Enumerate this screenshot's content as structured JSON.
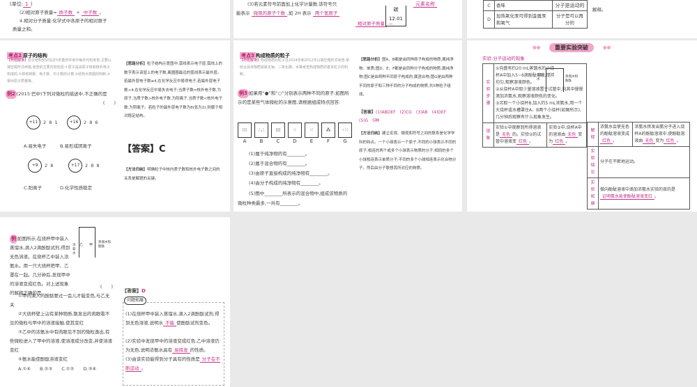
{
  "top_left": {
    "l1": "(2)相对原子质量≈",
    "a1": "质子数",
    "plus": "+",
    "a2": "中子数",
    "l2": "4.相对分子质量:化学式中各原子的相对原子",
    "l3": "质量之和。",
    "unit": "(单位:",
    "unit_a": "1"
  },
  "top_mid": {
    "l1": "(3)若元素符号前面加上化学计量数,该符号只",
    "l2": "能表示",
    "a1": "微观的原子个数",
    "l3": ",如 2H 表示",
    "a2": "两个氢原子",
    "box_label": "碳",
    "box_value": "12.01",
    "a3": "相对原子质量",
    "a4": "元素名称"
  },
  "top_right": {
    "rows": [
      {
        "k": "C",
        "d": "香味",
        "e": "分子是运动的"
      },
      {
        "k": "D",
        "d": "加热氧化汞可得到金属汞和氧气",
        "e": "分子是可以再分的"
      }
    ],
    "note": "解释。"
  },
  "p1": {
    "tag": "考点2",
    "title": "原子的结构",
    "intro_label": "【命题解读】",
    "intro": "原子结构知识在近5年重庆中考中每年均有考查,主要以填空题形式命题,考查的主要内容包括:①原子是由原子核和核外电子构成的,②核电荷数、电子数、中子数的计算,③结构示意图的判断,④相对原子质量等。",
    "ex_label": "例2",
    "q": "(2015·巴中)下列对微粒的描述中,不正确的是",
    "paren": "(　　)",
    "options": [
      {
        "core": "+11",
        "shells": "2 8 1",
        "label": "A.易失电子"
      },
      {
        "core": "+16",
        "shells": "2 8 6",
        "label": "B.易形成阴离子"
      },
      {
        "core": "+9",
        "shells": "2 8",
        "label": "C.阳离子"
      },
      {
        "core": "+17",
        "shells": "2 8 8",
        "label": "D.化学性质稳定"
      }
    ],
    "analysis_label": "【思路分析】",
    "analysis": "粒子结构示意图中,弧线表示电子层,弧线上的数字表示该层上的电子数,离圆圈最远的弧线表示最外层。若最外层电子数≥4,在化学反应中易得电子,若最外层电子数<4,在化学反应中易失去电子;当质子数=核外电子数,为原子,当质子数>核外电子数,为阳离子,当质子数<核外电子数,为阴离子。若粒子的最外层电子数为8(氦为2),则属于相对稳定结构。",
    "answer_label": "【答案】",
    "answer": "C",
    "method_label": "【方法归纳】",
    "method": "明确粒子中核内质子数和核外电子数之间的关系是解题的关键。"
  },
  "p2": {
    "tag": "考点3",
    "title": "构成物质的粒子",
    "intro_label": "【命题解读】",
    "intro": "构成物质的粒子在2014年和2012年以填空题形式考查,常结合具体物质如氯化钠、二氧化碳、水等考查构成物质的基本粒子的判断。",
    "ex_label": "例3",
    "q": "如果用“●”和“○”分别表示两种不同的原子,如图所示的是某些气体微粒的示意图,请根据组成特点回答:",
    "boxes": [
      "A",
      "B",
      "C",
      "D",
      "E",
      "F",
      "G"
    ],
    "qs": [
      "(1)属于纯净物的有________。",
      "(2)属于混合物的有________。",
      "(3)由原子直接构成的纯净物有________。",
      "(4)由分子构成的纯净物有________。",
      "(5)图中________所表示的混合物中,组成该物质的微粒种类最多,一共有________。"
    ],
    "analysis_label": "【思路分析】",
    "analysis": "图A、B都是由同种原子构成的物质,属纯净物、单质;图D、E、F都是由同种分子构成的物质,属纯净物;图C是由两种不同原子构成的,属混合物;图G是由两种不同的原子和三种不同的分子构成的物质,共5种粒子组成。",
    "answer_label": "【答案】",
    "answer": "(1)ABDEF　(2)CG　(3)AB　(4)DEF　(5)G　5种",
    "method_label": "【方法归纳】",
    "method": "建立宏观、微观和符号之间的联系是化学学科的特点。一个小球表示一个原子,不同的小球表示不同的原子;相连的两个或多个小球表示物质的分子;相同的多个小球相连表示单质分子;不同的多个小球相连表示化合物分子。然后由分子联想其所对应的物质。"
  },
  "p3": {
    "banner": "重要实验突破",
    "exp_title": "实验:分子运动的现象",
    "steps_label": "实验步骤",
    "step1": "①向盛有约20 mL蒸馏水的小烧杯A中加入5~6滴酚酞溶液,搅拌均匀,观察溶液颜色。",
    "step2": "②从烧杯A中取少量溶液置于试管中,向其中慢慢滴加浓氨水,观察溶液颜色的变化。",
    "step3": "③另取一个小烧杯B,加入约5 mL浓氨水,用一个大烧杯或水槽罩住A、B两个小烧杯(如图所示),几分钟后观察有什么现象发生。",
    "fig_left": "浓氨水",
    "fig_right": "蒸馏水和酚酞",
    "phen_label": "现象",
    "phen1a": "实验①中观察到所得溶液是",
    "phen1b": "无色",
    "phen1c": "的。实验②的试管中溶液变",
    "phen1d": "红色",
    "phen2a": "实验③中,烧杯A中的溶液由",
    "phen2b": "无色",
    "phen2c": "变为",
    "phen2d": "红色",
    "expl_label": "解释",
    "expl1a": "浓氨水会使无色的酚酞溶液变成",
    "expl1b": "红色",
    "expl2a": "浓氨水挥发出氨分子进入烧杯A的酚酞溶液中,使酚酞溶液由",
    "expl2b": "无色",
    "expl2c": "变为",
    "expl2d": "红色",
    "concl_label": "实验结论",
    "concl": "分子在不断地运动。",
    "ext_label": "实验拓展",
    "ext": "做向酚酞溶液中滴加浓氨水实验的目的是",
    "ext_a": "证明氨水能使酚酞溶液变红"
  },
  "p4": {
    "ex_label": "例",
    "q": "如图所示,在烧杯甲中装入蒸馏水,滴入2滴酚酞试剂,得到无色溶液。在烧杯乙中装入浓氨水。用一只大烧杯把甲、乙罩在一起。几分钟后,发现甲中的溶液变成红色。对上述现象的解释正确的是",
    "paren": "(　　)",
    "fig_left": "浓氨水",
    "fig_right": "蒸馏水和酚酞",
    "b1": "乙",
    "b2": "甲",
    "items": [
      "①甲内滴入的酚酞要过一会儿才能变色,与乙无关",
      "②大烧杯壁上沾有某种物质,散发出的肉眼看不见的微粒与甲中的溶液接触,使其变红",
      "③乙中的浓氨水中有肉眼见不到的微粒逸出,有些微粒进入了甲中的溶液,使溶液成分改变,并使溶液变红",
      "④氨水能使酚酞溶液变红"
    ],
    "choices": "A.①④　　B.②③　　C.①②　　D.③④",
    "answer_label": "【答案】",
    "answer": "D",
    "ext_title": "问题拓展",
    "e1a": "(1)在烧杯甲中装入蒸馏水,滴入2滴酚酞试剂,得到无色溶液,说明水",
    "e1b": "不能",
    "e1c": "使酚酞试剂变色。",
    "e2a": "(2)实验中发现甲中的溶液变成红色,乙中溶液仍为无色,说明浓氨水具有",
    "e2b": "易挥发",
    "e2c": "的性质。",
    "e3a": "(3)由该实验能得到分子具有的性质是",
    "e3b": "分子在不断运动",
    "e3c": "。"
  }
}
